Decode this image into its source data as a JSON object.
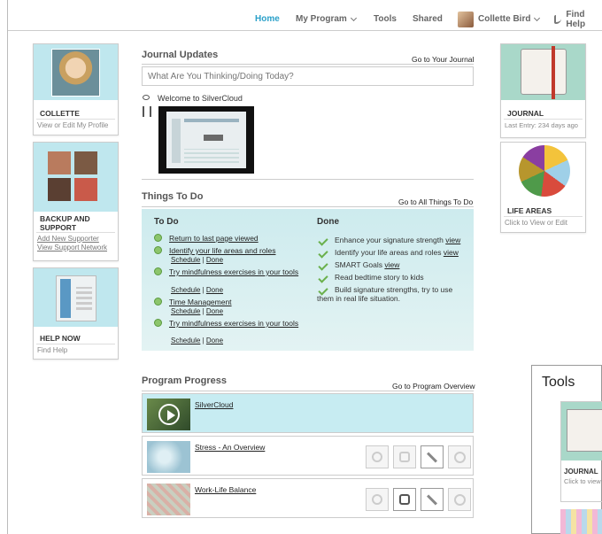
{
  "nav": {
    "home": "Home",
    "program": "My Program",
    "tools": "Tools",
    "shared": "Shared",
    "user": "Collette Bird",
    "help": "Find Help"
  },
  "profile": {
    "name": "COLLETTE",
    "link": "View or Edit My Profile"
  },
  "backup": {
    "title": "BACKUP AND SUPPORT",
    "link1": "Add New Supporter",
    "link2": "View Support Network"
  },
  "help": {
    "title": "HELP NOW",
    "link": "Find Help"
  },
  "journal_updates": {
    "title": "Journal Updates",
    "link": "Go to Your Journal",
    "placeholder": "What Are You Thinking/Doing Today?",
    "post": "Welcome to SilverCloud"
  },
  "things": {
    "title": "Things To Do",
    "link": "Go to All Things To Do",
    "todo_title": "To Do",
    "done_title": "Done",
    "todo": [
      "Return to last page viewed",
      "Identify your life areas and roles",
      "Try mindfulness exercises in your tools",
      "Time Management",
      "Try mindfulness exercises in your tools"
    ],
    "schedule": "Schedule",
    "sep": "|",
    "done_label": "Done",
    "done": [
      {
        "text": "Enhance your signature strength",
        "link": "view"
      },
      {
        "text": "Identify your life areas and roles",
        "link": "view"
      },
      {
        "text": "SMART Goals",
        "link": "view"
      },
      {
        "text": "Read bedtime story to kids",
        "link": ""
      },
      {
        "text": "Build signature strengths, try to use them in real life situation.",
        "link": ""
      }
    ]
  },
  "progress": {
    "title": "Program Progress",
    "link": "Go to Program Overview",
    "modules": [
      "SilverCloud",
      "Stress - An Overview",
      "Work-Life Balance"
    ]
  },
  "journal_card": {
    "title": "JOURNAL",
    "sub": "Last Entry: 234 days ago"
  },
  "life_card": {
    "title": "LIFE AREAS",
    "sub": "Click to View or Edit"
  },
  "tools_panel": {
    "title": "Tools",
    "card_title": "JOURNAL",
    "card_sub": "Click to view"
  },
  "colors": {
    "accent": "#2aa0c9",
    "card_bg": "#bfe7ee",
    "todo_bg": "#cdebee"
  }
}
